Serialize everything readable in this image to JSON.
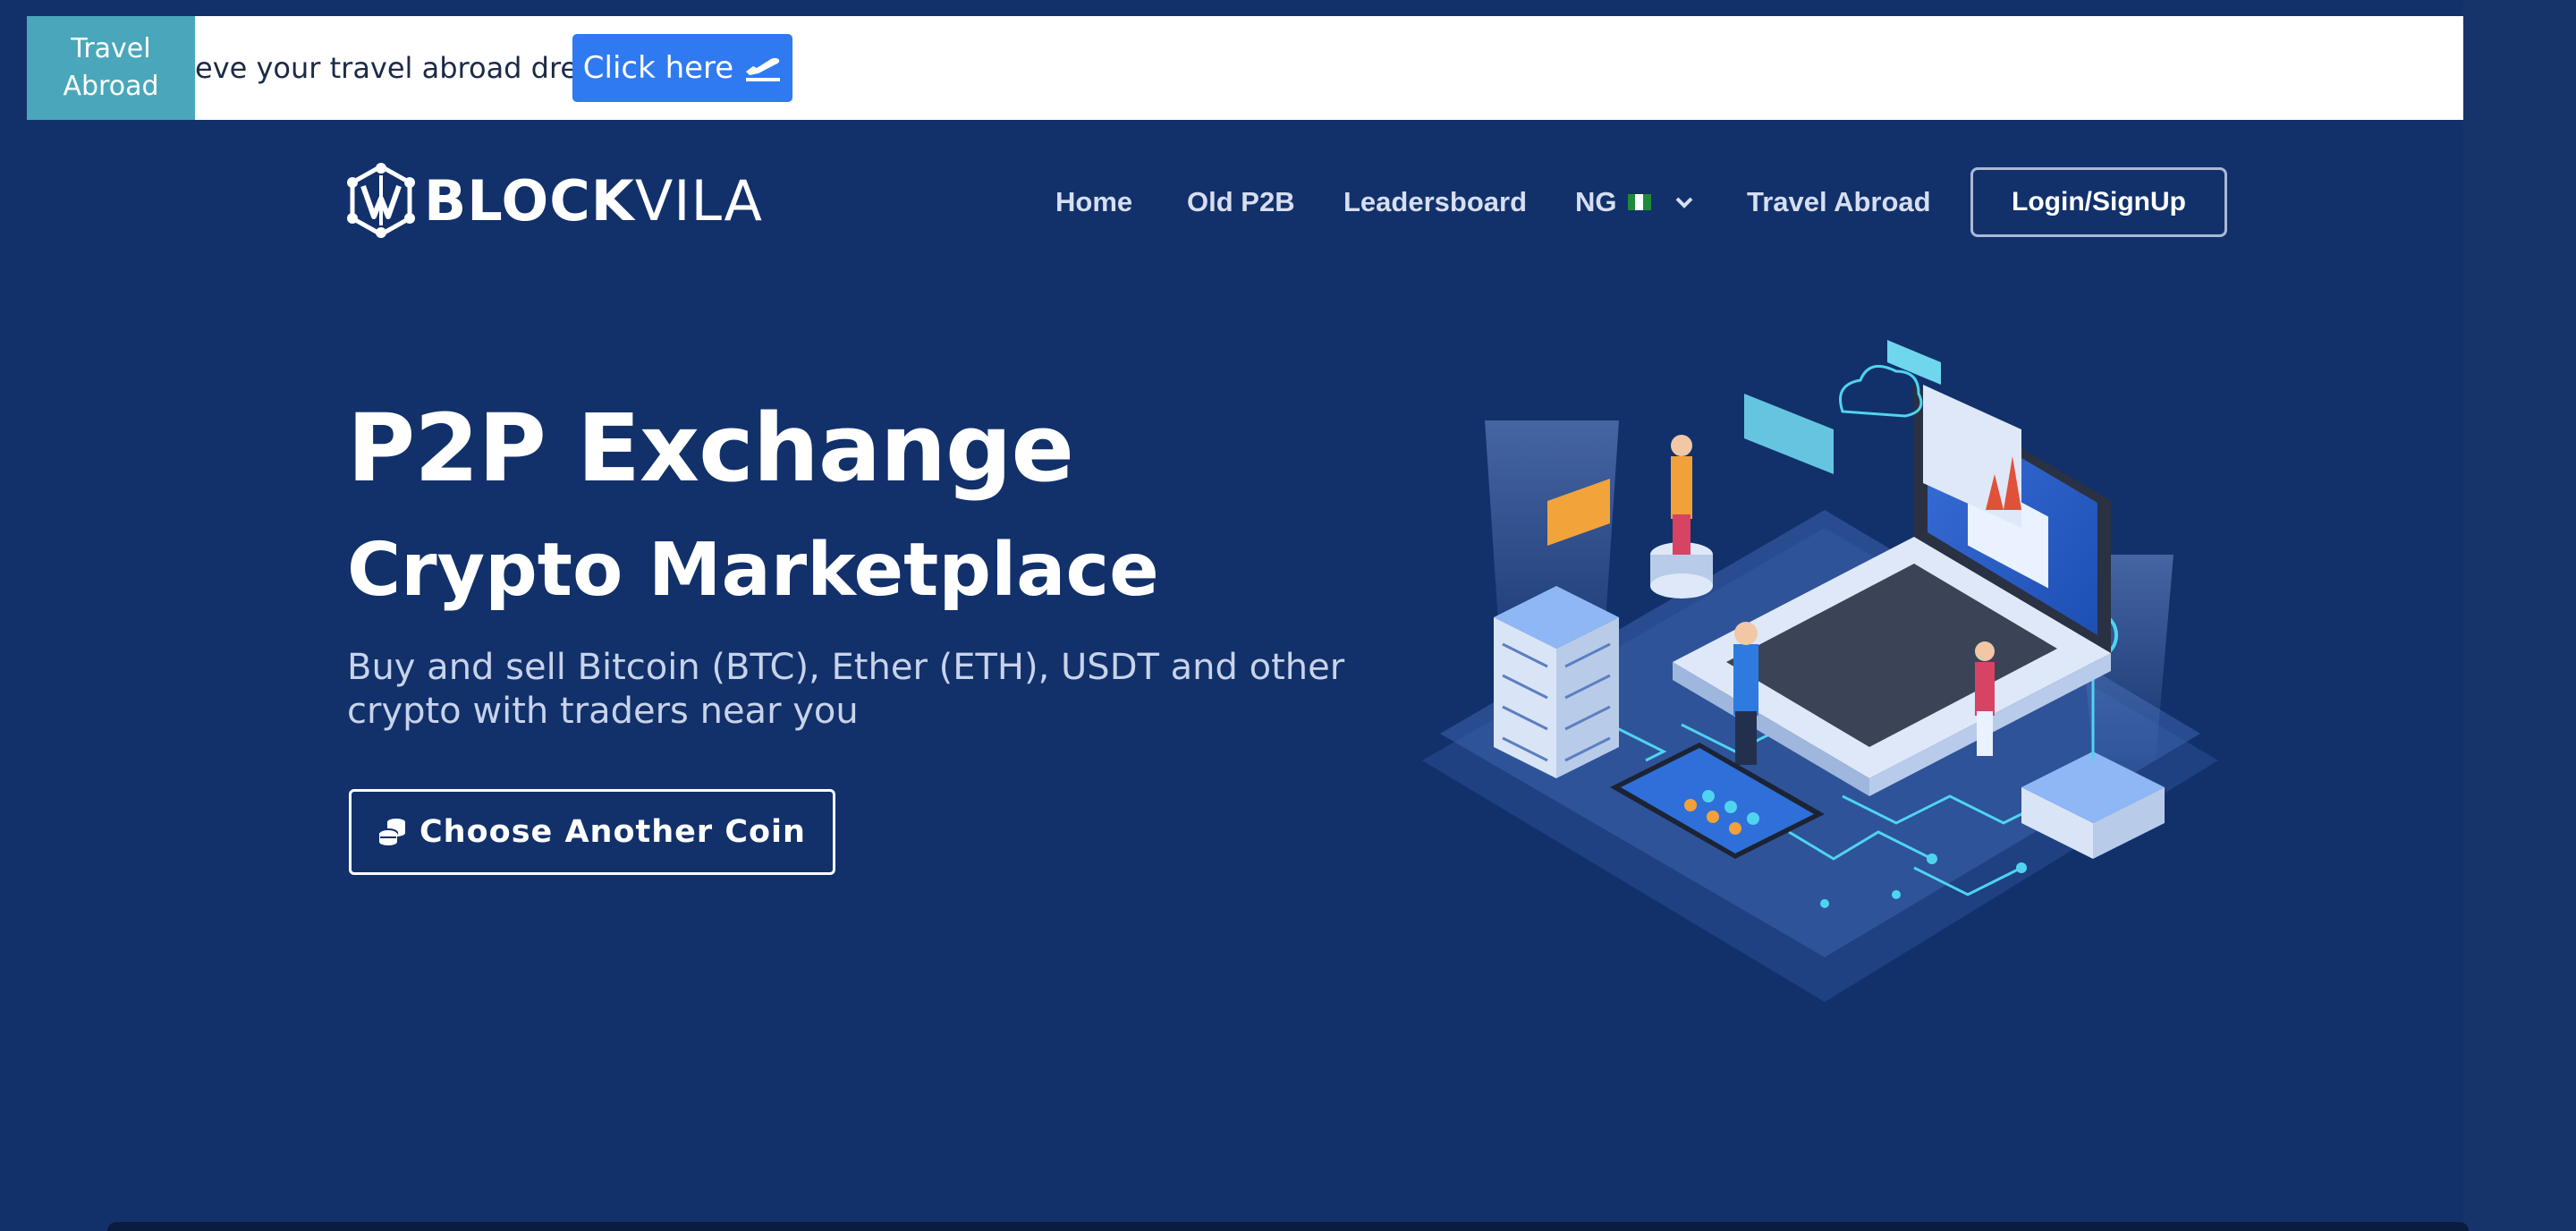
{
  "announcement": {
    "tag_line1": "Travel",
    "tag_line2": "Abroad",
    "text": "eve your travel abroad dream.",
    "button_label": "Click here",
    "button_icon": "plane-departure-icon"
  },
  "brand": {
    "logo_icon": "blockvila-logo-icon",
    "name_bold": "BLOCK",
    "name_light": "VILA"
  },
  "nav": {
    "items": [
      {
        "label": "Home"
      },
      {
        "label": "Old P2B"
      },
      {
        "label": "Leadersboard"
      },
      {
        "label": "NG"
      },
      {
        "label": "Travel Abroad"
      }
    ],
    "country_flag_icon": "nigeria-flag-icon",
    "dropdown_icon": "chevron-down-icon",
    "login_label": "Login/SignUp"
  },
  "hero": {
    "title": "P2P Exchange",
    "subtitle": "Crypto Marketplace",
    "description": "Buy and sell Bitcoin (BTC), Ether (ETH), USDT and other crypto with traders near you",
    "button_label": "Choose Another Coin",
    "button_icon": "coins-icon"
  },
  "colors": {
    "background": "#12316b",
    "announce_tag": "#4aa7bb",
    "click_button": "#2f7af0",
    "nav_text": "#d6def0",
    "accent_cyan": "#4fd4f0"
  }
}
